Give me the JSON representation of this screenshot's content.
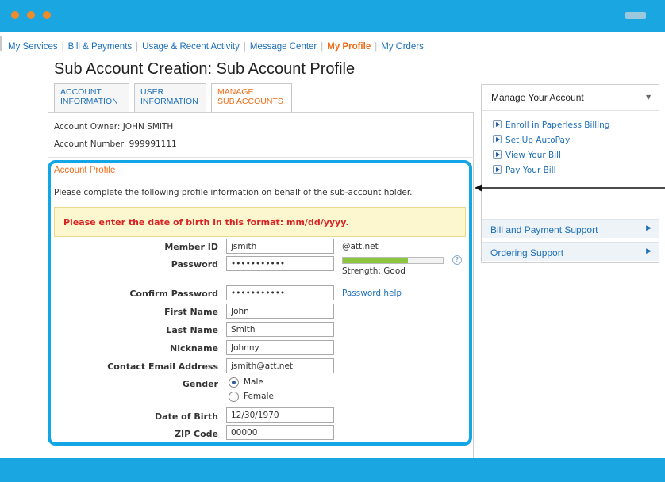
{
  "nav": {
    "items": [
      {
        "label": "My Services",
        "active": false
      },
      {
        "label": "Bill & Payments",
        "active": false
      },
      {
        "label": "Usage & Recent Activity",
        "active": false
      },
      {
        "label": "Message Center",
        "active": false
      },
      {
        "label": "My Profile",
        "active": true
      },
      {
        "label": "My Orders",
        "active": false
      }
    ]
  },
  "page": {
    "title": "Sub Account Creation: Sub Account Profile"
  },
  "tabs": [
    {
      "line1": "ACCOUNT",
      "line2": "INFORMATION"
    },
    {
      "line1": "USER",
      "line2": "INFORMATION"
    },
    {
      "line1": "MANAGE",
      "line2": "SUB ACCOUNTS"
    }
  ],
  "account": {
    "owner": "Account Owner: JOHN SMITH",
    "number": "Account Number: 999991111"
  },
  "profile": {
    "title": "Account Profile",
    "instructions": "Please complete the following profile information on behalf of the sub-account holder.",
    "alert": "Please enter the date of birth in this format: mm/dd/yyyy.",
    "member_id": {
      "label": "Member ID",
      "value": "jsmith",
      "suffix": "@att.net"
    },
    "password": {
      "label": "Password",
      "value": "•••••••••••"
    },
    "strength": {
      "label": "Strength: Good",
      "fill_percent": 65,
      "help": "?"
    },
    "confirm_password": {
      "label": "Confirm Password",
      "value": "•••••••••••",
      "help_link": "Password help"
    },
    "first_name": {
      "label": "First Name",
      "value": "John"
    },
    "last_name": {
      "label": "Last Name",
      "value": "Smith"
    },
    "nickname": {
      "label": "Nickname",
      "value": "Johnny"
    },
    "email": {
      "label": "Contact Email Address",
      "value": "jsmith@att.net"
    },
    "gender": {
      "label": "Gender",
      "options": [
        "Male",
        "Female"
      ],
      "selected": "Male"
    },
    "dob": {
      "label": "Date of Birth",
      "value": "12/30/1970"
    },
    "zip": {
      "label": "ZIP Code",
      "value": "00000"
    }
  },
  "sidebar": {
    "title": "Manage Your Account",
    "links": [
      "Enroll in Paperless Billing",
      "Set Up AutoPay",
      "View Your Bill",
      "Pay Your Bill"
    ],
    "sections": [
      "Bill and Payment Support",
      "Ordering Support"
    ]
  },
  "colors": {
    "accent": "#1aa6e0",
    "highlight": "#13a6e6",
    "orange": "#f06c18",
    "link": "#1d6fb8",
    "alert": "#d72323"
  }
}
